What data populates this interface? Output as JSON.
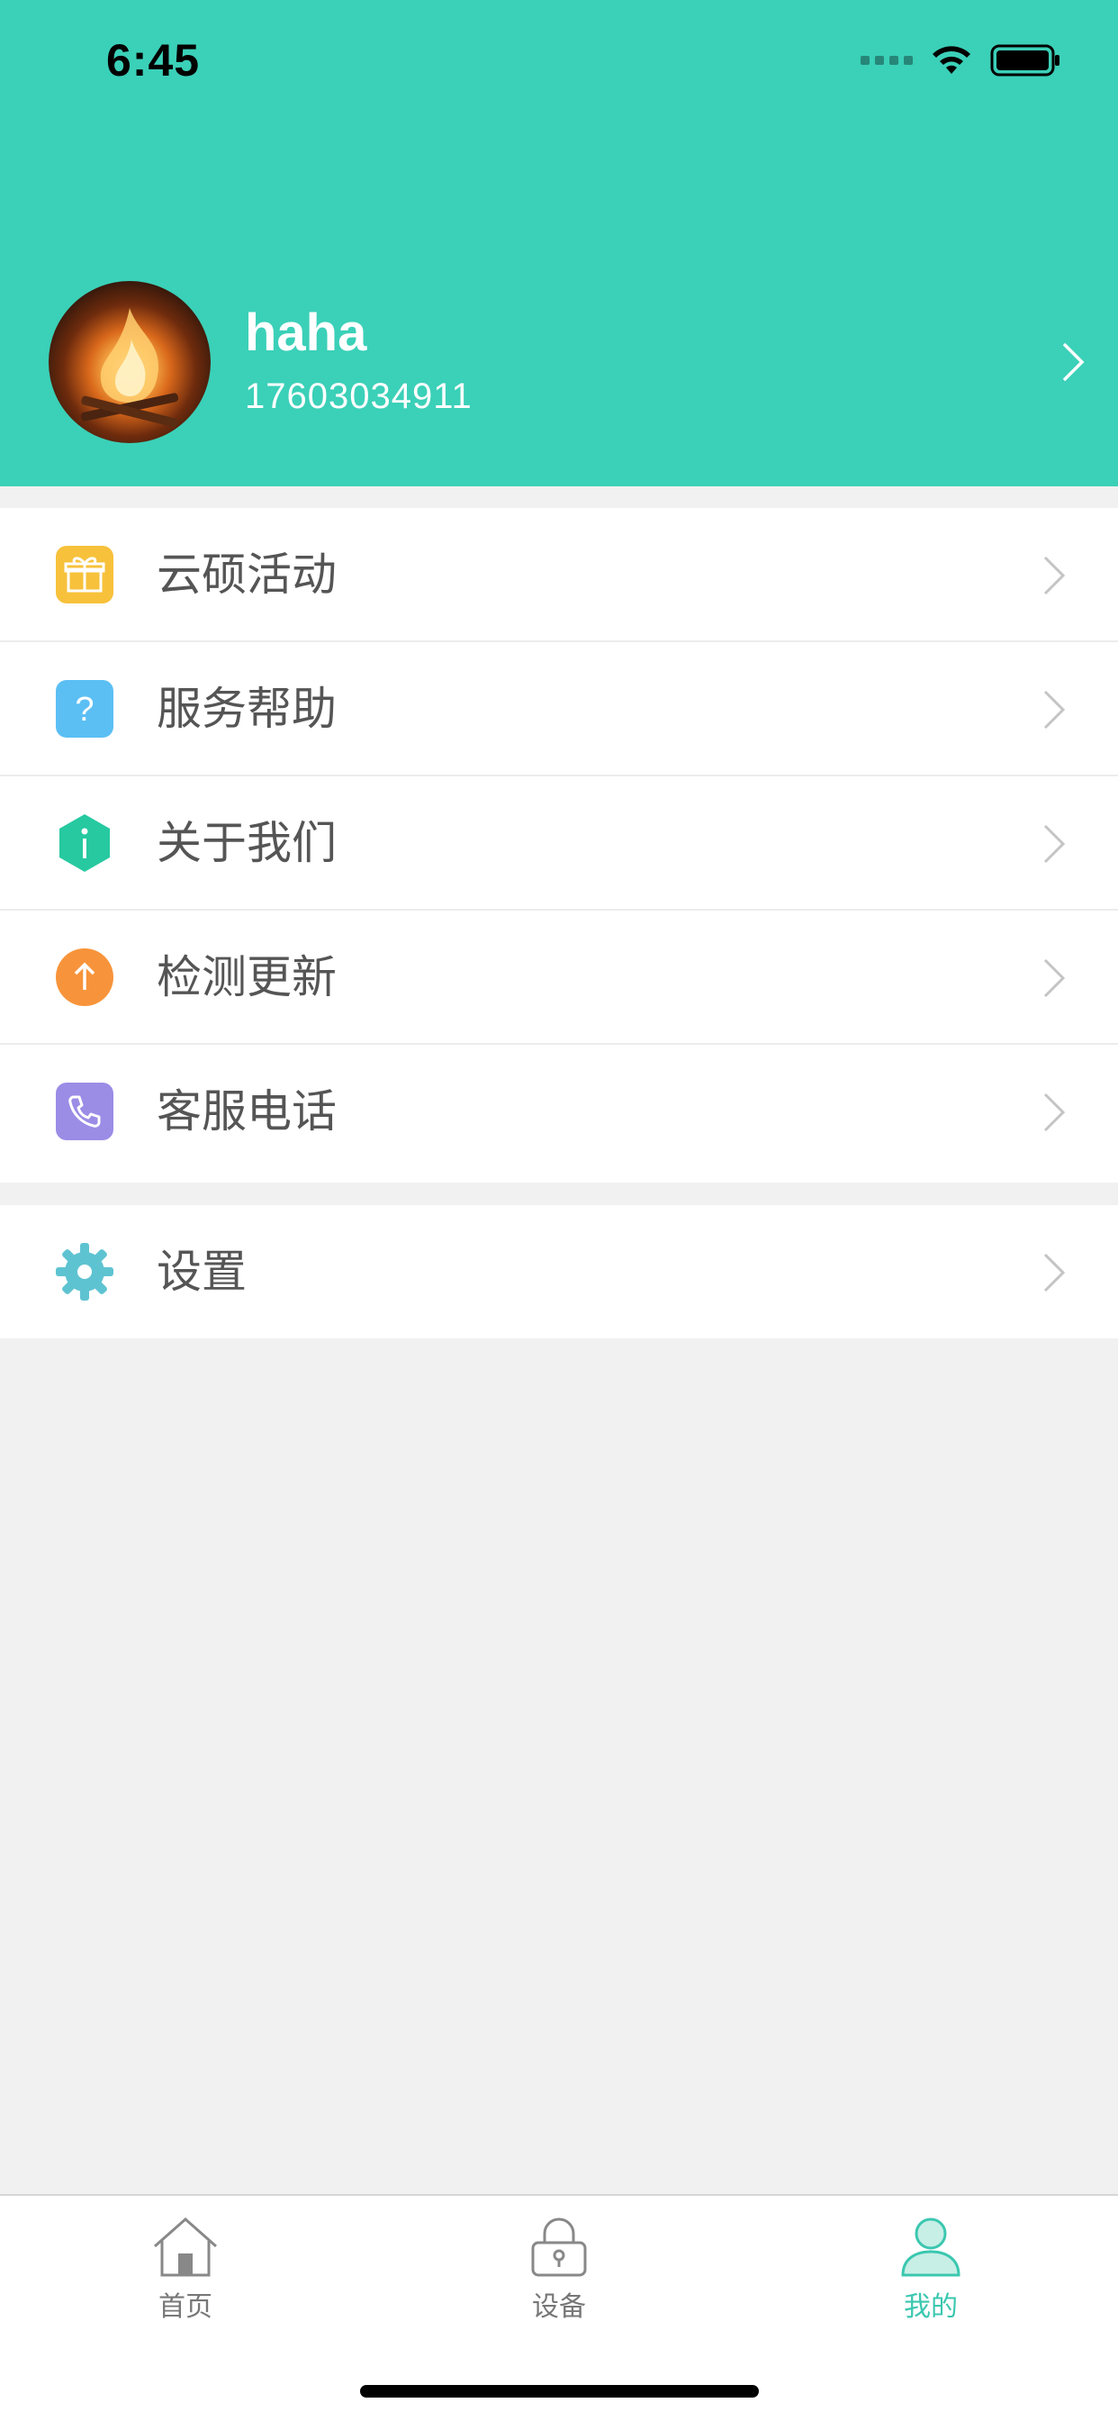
{
  "status_bar": {
    "time": "6:45"
  },
  "profile": {
    "name": "haha",
    "phone": "17603034911"
  },
  "menu": {
    "group1": [
      {
        "label": "云硕活动",
        "icon": "gift-icon",
        "color": "#f7c13b"
      },
      {
        "label": "服务帮助",
        "icon": "question-icon",
        "color": "#5bbff4"
      },
      {
        "label": "关于我们",
        "icon": "info-icon",
        "color": "#27c9a0"
      },
      {
        "label": "检测更新",
        "icon": "arrow-up-icon",
        "color": "#f7943b"
      },
      {
        "label": "客服电话",
        "icon": "phone-icon",
        "color": "#9b8ce6"
      }
    ],
    "group2": [
      {
        "label": "设置",
        "icon": "gear-icon",
        "color": "#5ec3d1"
      }
    ]
  },
  "tabbar": {
    "tabs": [
      {
        "label": "首页",
        "icon": "home-icon",
        "active": false
      },
      {
        "label": "设备",
        "icon": "lock-icon",
        "active": false
      },
      {
        "label": "我的",
        "icon": "user-icon",
        "active": true
      }
    ],
    "active_color": "#3bc7b0"
  },
  "colors": {
    "header": "#3bd0b8",
    "background": "#f1f1f1"
  }
}
